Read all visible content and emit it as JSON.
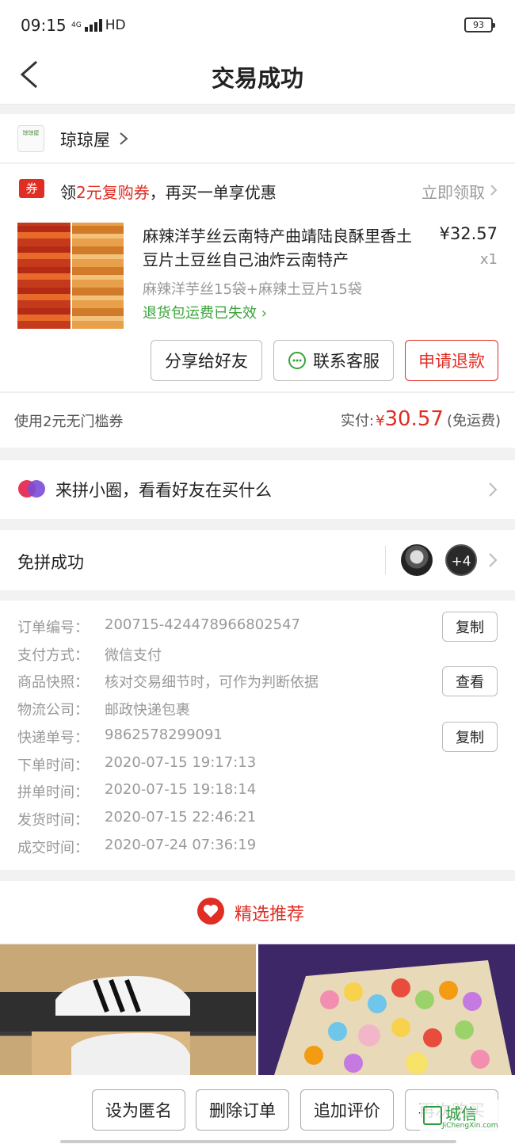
{
  "status_bar": {
    "time": "09:15",
    "network": "HD",
    "net_gen": "4G",
    "battery": "93"
  },
  "nav": {
    "title": "交易成功"
  },
  "shop": {
    "name": "琼琼屋",
    "logo_text": "琼琼屋"
  },
  "coupon": {
    "tag": "券",
    "prefix": "领",
    "amount": "2元复购券",
    "suffix": "，再买一单享优惠",
    "claim": "立即领取"
  },
  "product": {
    "title": "麻辣洋芋丝云南特产曲靖陆良酥里香土豆片土豆丝自己油炸云南特产",
    "price": "¥32.57",
    "qty": "x1",
    "spec": "麻辣洋芋丝15袋+麻辣土豆片15袋",
    "return_text": "退货包运费已失效",
    "buttons": {
      "share": "分享给好友",
      "service": "联系客服",
      "refund": "申请退款"
    }
  },
  "payment": {
    "coupon_used": "使用2元无门槛券",
    "label": "实付:",
    "currency": "¥",
    "amount": "30.57",
    "note": "(免运费)"
  },
  "circle": {
    "text": "来拼小圈，看看好友在买什么"
  },
  "group": {
    "text": "免拼成功",
    "extra": "+4"
  },
  "order_info": {
    "order_no_label": "订单编号：",
    "order_no": "200715-424478966802547",
    "pay_label": "支付方式：",
    "pay": "微信支付",
    "snapshot_label": "商品快照：",
    "snapshot": "核对交易细节时，可作为判断依据",
    "logistics_label": "物流公司：",
    "logistics": "邮政快递包裹",
    "tracking_label": "快递单号：",
    "tracking": "9862578299091",
    "ordered_label": "下单时间：",
    "ordered": "2020-07-15 19:17:13",
    "grouped_label": "拼单时间：",
    "grouped": "2020-07-15 19:18:14",
    "shipped_label": "发货时间：",
    "shipped": "2020-07-15 22:46:21",
    "completed_label": "成交时间：",
    "completed": "2020-07-24 07:36:19",
    "copy": "复制",
    "view": "查看"
  },
  "recommend": {
    "title": "精选推荐"
  },
  "bottom": {
    "anonymous": "设为匿名",
    "delete": "删除订单",
    "review": "追加评价",
    "rebuy": "再次购买"
  },
  "watermark": {
    "cn": "城信",
    "en": "JiChengXin.com"
  },
  "colors": {
    "accent": "#e02e24",
    "green": "#3aa33a",
    "bg": "#f2f2f2"
  }
}
